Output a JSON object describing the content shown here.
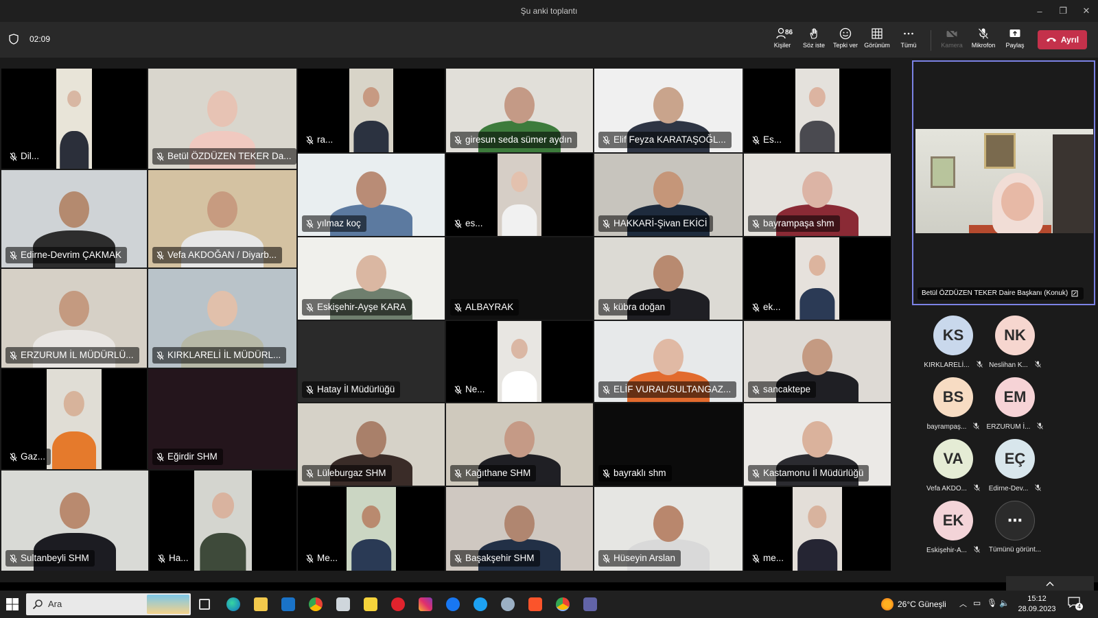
{
  "window": {
    "title": "Şu anki toplantı"
  },
  "toolbar": {
    "timer": "02:09",
    "people_count": "86",
    "people_label": "Kişiler",
    "raise_hand_label": "Söz iste",
    "react_label": "Tepki ver",
    "view_label": "Görünüm",
    "more_label": "Tümü",
    "camera_label": "Kamera",
    "mic_label": "Mikrofon",
    "share_label": "Paylaş",
    "leave_label": "Ayrıl"
  },
  "tiles": [
    {
      "name": "Dil..."
    },
    {
      "name": "Betül ÖZDÜZEN TEKER  Da..."
    },
    {
      "name": "ra..."
    },
    {
      "name": "giresun seda sümer aydın"
    },
    {
      "name": "Elif Feyza KARATAŞOĞL..."
    },
    {
      "name": "Es..."
    },
    {
      "name": "Edirne-Devrim ÇAKMAK"
    },
    {
      "name": "Vefa AKDOĞAN / Diyarb..."
    },
    {
      "name": "yılmaz koç"
    },
    {
      "name": "es..."
    },
    {
      "name": "HAKKARİ-Şivan EKİCİ"
    },
    {
      "name": "bayrampaşa shm"
    },
    {
      "name": "ERZURUM İL MÜDÜRLÜ..."
    },
    {
      "name": "KIRKLARELİ İL MÜDÜRL..."
    },
    {
      "name": "Eskişehir-Ayşe KARA"
    },
    {
      "name": "ALBAYRAK"
    },
    {
      "name": "kübra doğan"
    },
    {
      "name": "ek..."
    },
    {
      "name": "Gaz..."
    },
    {
      "name": "Eğirdir SHM"
    },
    {
      "name": "Hatay İl Müdürlüğü"
    },
    {
      "name": "Ne..."
    },
    {
      "name": "ELİF VURAL/SULTANGAZ..."
    },
    {
      "name": "sancaktepe"
    },
    {
      "name": "Lüleburgaz SHM"
    },
    {
      "name": "Kağıthane SHM"
    },
    {
      "name": "bayraklı shm"
    },
    {
      "name": "Kastamonu İl Müdürlüğü"
    },
    {
      "name": "Sultanbeyli SHM"
    },
    {
      "name": "Ha..."
    },
    {
      "name": "Me..."
    },
    {
      "name": "Başakşehir SHM"
    },
    {
      "name": "Hüseyin Arslan"
    },
    {
      "name": "me..."
    }
  ],
  "spotlight": {
    "name": "Betül ÖZDÜZEN TEKER Daire Başkanı (Konuk)"
  },
  "roster": [
    {
      "initials": "KS",
      "name": "KIRKLARELİ...",
      "color": "#c9d8ec"
    },
    {
      "initials": "NK",
      "name": "Neslihan K...",
      "color": "#f6d6cf"
    },
    {
      "initials": "BS",
      "name": "bayrampaş...",
      "color": "#f7dcc3"
    },
    {
      "initials": "EM",
      "name": "ERZURUM İ...",
      "color": "#f6d3d6"
    },
    {
      "initials": "VA",
      "name": "Vefa AKDO...",
      "color": "#e5ecd5"
    },
    {
      "initials": "EÇ",
      "name": "Edirne-Dev...",
      "color": "#d8e6ec"
    },
    {
      "initials": "EK",
      "name": "Eskişehir-A...",
      "color": "#f3d4d8"
    },
    {
      "initials": "⋯",
      "name": "Tümünü görünt...",
      "color": "#2b2b2b"
    }
  ],
  "taskbar": {
    "search_text": "Ara",
    "weather": "26°C  Güneşli",
    "time": "15:12",
    "date": "28.09.2023",
    "notifications": "4"
  }
}
